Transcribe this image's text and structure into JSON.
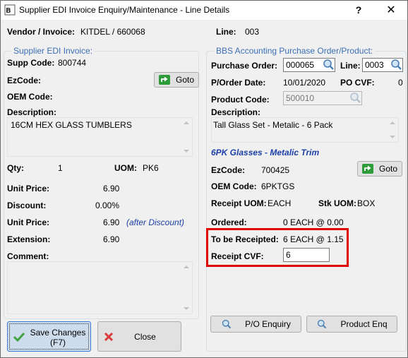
{
  "window": {
    "title": "Supplier EDI Invoice Enquiry/Maintenance - Line Details",
    "help_glyph": "?",
    "close_glyph": "✕"
  },
  "header": {
    "vendor_label": "Vendor / Invoice:",
    "vendor_value": "KITDEL / 660068",
    "line_label": "Line:",
    "line_value": "003"
  },
  "left": {
    "group_title": "Supplier EDI Invoice:",
    "supp_code_label": "Supp Code:",
    "supp_code_value": "800744",
    "ezcode_label": "EzCode:",
    "goto_label": "Goto",
    "oem_label": "OEM Code:",
    "desc_label": "Description:",
    "desc_value": "16CM HEX GLASS TUMBLERS",
    "qty_label": "Qty:",
    "qty_value": "1",
    "uom_label": "UOM:",
    "uom_value": "PK6",
    "unit_price_label": "Unit Price:",
    "unit_price_value": "6.90",
    "discount_label": "Discount:",
    "discount_value": "0.00%",
    "unit_price2_label": "Unit Price:",
    "unit_price2_value": "6.90",
    "after_discount": "(after Discount)",
    "extension_label": "Extension:",
    "extension_value": "6.90",
    "comment_label": "Comment:"
  },
  "right": {
    "group_title": "BBS Accounting Purchase Order/Product:",
    "po_label": "Purchase Order:",
    "po_value": "000065",
    "line_label": "Line:",
    "line_value": "0003",
    "po_date_label": "P/Order Date:",
    "po_date_value": "10/01/2020",
    "po_cvf_label": "PO CVF:",
    "po_cvf_value": "0",
    "product_code_label": "Product Code:",
    "product_code_value": "500010",
    "desc_label": "Description:",
    "desc_value": "Tall Glass Set - Metalic - 6 Pack",
    "product_title": "6PK Glasses - Metalic Trim",
    "ezcode_label": "EzCode:",
    "ezcode_value": "700425",
    "goto_label": "Goto",
    "oem_label": "OEM Code:",
    "oem_value": "6PKTGS",
    "receipt_uom_label": "Receipt UOM:",
    "receipt_uom_value": "EACH",
    "stk_uom_label": "Stk UOM:",
    "stk_uom_value": "BOX",
    "ordered_label": "Ordered:",
    "ordered_value": "0 EACH @ 0.00",
    "to_receipt_label": "To be Receipted:",
    "to_receipt_value": "6 EACH @ 1.15",
    "receipt_cvf_label": "Receipt CVF:",
    "receipt_cvf_value": "6",
    "po_enquiry_label": "P/O Enquiry",
    "product_enq_label": "Product Enq"
  },
  "footer": {
    "save_label_line1": "Save Changes",
    "save_label_line2": "(F7)",
    "close_label": "Close"
  },
  "colors": {
    "accent_blue": "#3c6fb7",
    "highlight_red": "#e00000",
    "goto_green": "#2e9b3a"
  }
}
